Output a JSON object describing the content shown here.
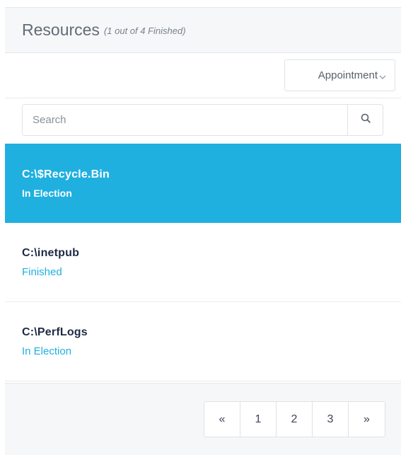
{
  "header": {
    "title": "Resources",
    "subtitle": "(1 out of 4 Finished)"
  },
  "toolbar": {
    "dropdown_label": "Appointment",
    "dropdown_icon": "chevron-down-icon"
  },
  "search": {
    "placeholder": "Search",
    "value": "",
    "icon": "search-icon"
  },
  "resources": [
    {
      "name": "C:\\$Recycle.Bin",
      "status": "In Election",
      "selected": true
    },
    {
      "name": "C:\\inetpub",
      "status": "Finished",
      "selected": false
    },
    {
      "name": "C:\\PerfLogs",
      "status": "In Election",
      "selected": false
    }
  ],
  "pagination": {
    "prev": "«",
    "pages": [
      "1",
      "2",
      "3"
    ],
    "next": "»"
  },
  "colors": {
    "accent": "#1fb0e0",
    "name_text": "#1f2a44",
    "header_bg": "#f5f7f9"
  }
}
